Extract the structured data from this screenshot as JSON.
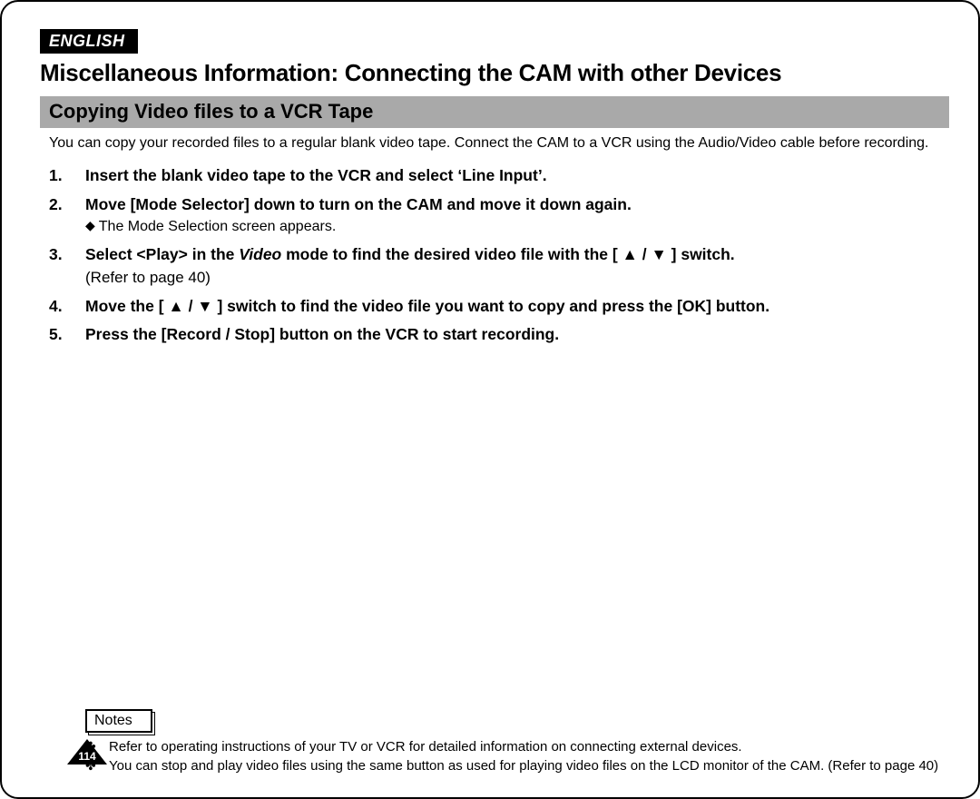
{
  "language_badge": "ENGLISH",
  "title": "Miscellaneous Information: Connecting the CAM with other Devices",
  "subtitle": "Copying Video files to a VCR Tape",
  "intro": "You can copy your recorded files to a regular blank video tape. Connect the CAM to a VCR using the Audio/Video cable before recording.",
  "steps": [
    {
      "main": "Insert the blank video tape to the VCR and select ‘Line Input’."
    },
    {
      "main": "Move [Mode Selector] down to turn on the CAM and move it down again.",
      "sub_bullet": "The Mode Selection screen appears."
    },
    {
      "main_pre": "Select <Play> in the ",
      "main_italic": "Video",
      "main_post": " mode to find the desired video file with the [ ▲ / ▼ ] switch.",
      "ref": "(Refer to page 40)"
    },
    {
      "main": "Move the [ ▲ / ▼ ] switch to find the video file you want to copy and press the [OK] button."
    },
    {
      "main": "Press the [Record / Stop] button on the VCR to start recording."
    }
  ],
  "notes_label": "Notes",
  "notes": [
    "Refer to operating instructions of your TV or VCR for detailed information on connecting external devices.",
    "You can stop and play video files using the same button as used for playing video files on the LCD monitor of the CAM. (Refer to page 40)"
  ],
  "page_number": "114"
}
